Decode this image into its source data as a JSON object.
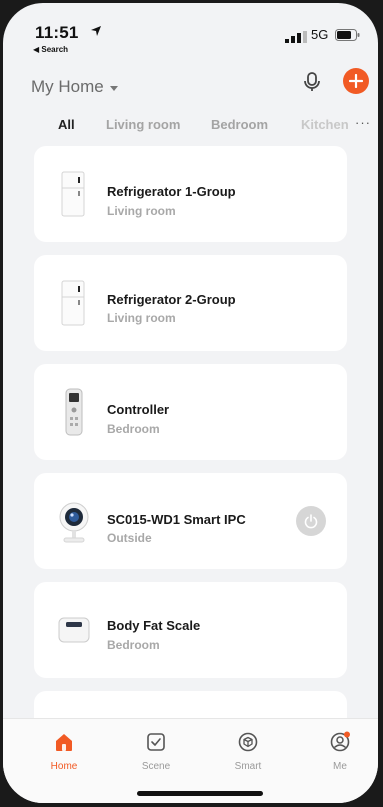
{
  "status_bar": {
    "time": "11:51",
    "back_label": "◀ Search",
    "network": "5G"
  },
  "header": {
    "home_name": "My Home"
  },
  "tabs": [
    {
      "label": "All"
    },
    {
      "label": "Living room"
    },
    {
      "label": "Bedroom"
    },
    {
      "label": "Kitchen"
    }
  ],
  "devices": [
    {
      "name": "Refrigerator 1-Group",
      "room": "Living room",
      "icon": "refrigerator-icon"
    },
    {
      "name": "Refrigerator 2-Group",
      "room": "Living room",
      "icon": "refrigerator-icon"
    },
    {
      "name": "Controller",
      "room": "Bedroom",
      "icon": "remote-control-icon"
    },
    {
      "name": "SC015-WD1 Smart IPC",
      "room": "Outside",
      "icon": "camera-icon"
    },
    {
      "name": "Body Fat Scale",
      "room": "Bedroom",
      "icon": "scale-icon"
    }
  ],
  "bottom_nav": [
    {
      "label": "Home",
      "icon": "home-icon",
      "active": true
    },
    {
      "label": "Scene",
      "icon": "scene-checkbox-icon"
    },
    {
      "label": "Smart",
      "icon": "smart-cube-icon"
    },
    {
      "label": "Me",
      "icon": "profile-icon",
      "badge": true
    }
  ],
  "colors": {
    "accent": "#f15a24",
    "background": "#f2f3f5",
    "card": "#ffffff"
  }
}
